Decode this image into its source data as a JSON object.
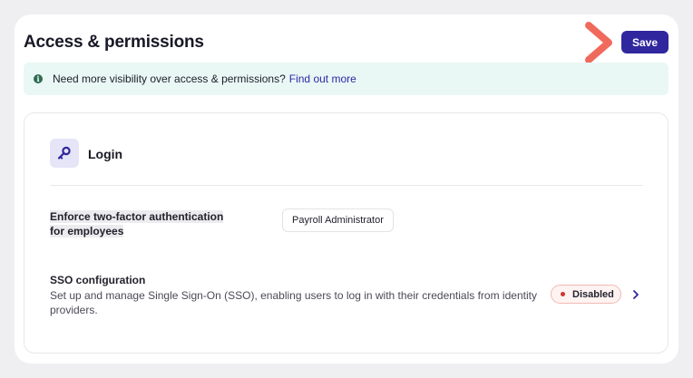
{
  "header": {
    "title": "Access & permissions",
    "save_label": "Save"
  },
  "banner": {
    "icon": "info-icon",
    "text": "Need more visibility over access & permissions?",
    "link_text": "Find out more"
  },
  "login_section": {
    "icon": "key-icon",
    "title": "Login",
    "settings": [
      {
        "label": "Enforce two-factor authentication for employees",
        "chip": "Payroll Administrator"
      },
      {
        "title": "SSO configuration",
        "description": "Set up and manage Single Sign-On (SSO), enabling users to log in with their credentials from identity providers.",
        "status": "Disabled",
        "status_color": "#d0352b"
      }
    ]
  },
  "colors": {
    "accent": "#30279e",
    "banner_bg": "#e9f7f5",
    "pointer": "#f06a5c"
  }
}
